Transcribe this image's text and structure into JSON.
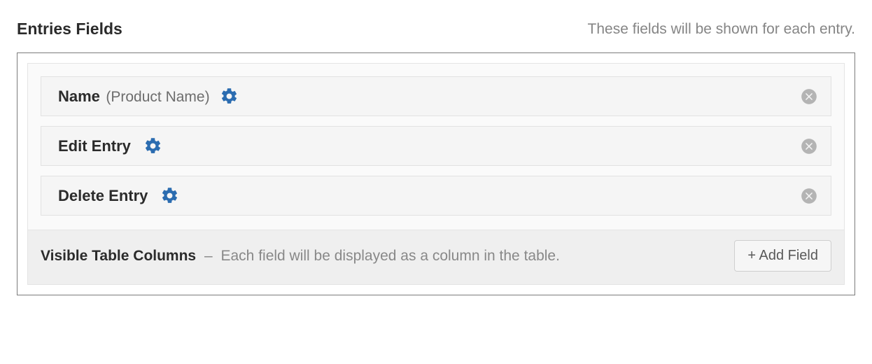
{
  "header": {
    "title": "Entries Fields",
    "description": "These fields will be shown for each entry."
  },
  "fields": [
    {
      "label": "Name",
      "sublabel": "(Product Name)"
    },
    {
      "label": "Edit Entry",
      "sublabel": ""
    },
    {
      "label": "Delete Entry",
      "sublabel": ""
    }
  ],
  "footer": {
    "title": "Visible Table Columns",
    "separator": "–",
    "description": "Each field will be displayed as a column in the table.",
    "add_button": "+ Add Field"
  }
}
